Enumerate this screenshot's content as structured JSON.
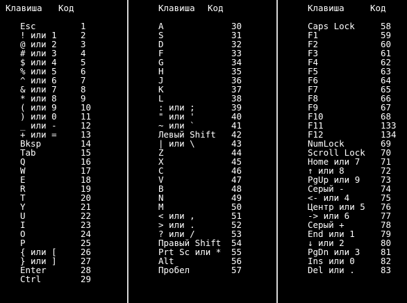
{
  "columns": [
    {
      "header_key": "Клавиша",
      "header_code": "Код",
      "rows": [
        {
          "key": "Esc",
          "code": "1"
        },
        {
          "key": "! или 1",
          "code": "2"
        },
        {
          "key": "@ или 2",
          "code": "3"
        },
        {
          "key": "# или 3",
          "code": "4"
        },
        {
          "key": "$ или 4",
          "code": "5"
        },
        {
          "key": "% или 5",
          "code": "6"
        },
        {
          "key": "^ или 6",
          "code": "7"
        },
        {
          "key": "& или 7",
          "code": "8"
        },
        {
          "key": "* или 8",
          "code": "9"
        },
        {
          "key": "( или 9",
          "code": "10"
        },
        {
          "key": ") или 0",
          "code": "11"
        },
        {
          "key": "_ или -",
          "code": "12"
        },
        {
          "key": "+ или =",
          "code": "13"
        },
        {
          "key": "Bksp",
          "code": "14"
        },
        {
          "key": "Tab",
          "code": "15"
        },
        {
          "key": "Q",
          "code": "16"
        },
        {
          "key": "W",
          "code": "17"
        },
        {
          "key": "E",
          "code": "18"
        },
        {
          "key": "R",
          "code": "19"
        },
        {
          "key": "T",
          "code": "20"
        },
        {
          "key": "Y",
          "code": "21"
        },
        {
          "key": "U",
          "code": "22"
        },
        {
          "key": "I",
          "code": "23"
        },
        {
          "key": "O",
          "code": "24"
        },
        {
          "key": "P",
          "code": "25"
        },
        {
          "key": "{ или [",
          "code": "26"
        },
        {
          "key": "} или ]",
          "code": "27"
        },
        {
          "key": "Enter",
          "code": "28"
        },
        {
          "key": "Ctrl",
          "code": "29"
        }
      ]
    },
    {
      "header_key": "Клавиша",
      "header_code": "Код",
      "rows": [
        {
          "key": "A",
          "code": "30"
        },
        {
          "key": "S",
          "code": "31"
        },
        {
          "key": "D",
          "code": "32"
        },
        {
          "key": "F",
          "code": "33"
        },
        {
          "key": "G",
          "code": "34"
        },
        {
          "key": "H",
          "code": "35"
        },
        {
          "key": "J",
          "code": "36"
        },
        {
          "key": "K",
          "code": "37"
        },
        {
          "key": "L",
          "code": "38"
        },
        {
          "key": ": или ;",
          "code": "39"
        },
        {
          "key": "\" или '",
          "code": "40"
        },
        {
          "key": "~ или `",
          "code": "41"
        },
        {
          "key": "Левый Shift",
          "code": "42"
        },
        {
          "key": "| или \\",
          "code": "43"
        },
        {
          "key": "Z",
          "code": "44"
        },
        {
          "key": "X",
          "code": "45"
        },
        {
          "key": "C",
          "code": "46"
        },
        {
          "key": "V",
          "code": "47"
        },
        {
          "key": "B",
          "code": "48"
        },
        {
          "key": "N",
          "code": "49"
        },
        {
          "key": "M",
          "code": "50"
        },
        {
          "key": "< или ,",
          "code": "51"
        },
        {
          "key": "> или .",
          "code": "52"
        },
        {
          "key": "? или /",
          "code": "53"
        },
        {
          "key": "Правый Shift",
          "code": "54"
        },
        {
          "key": "Prt Sc или *",
          "code": "55"
        },
        {
          "key": "Alt",
          "code": "56"
        },
        {
          "key": "Пробел",
          "code": "57"
        }
      ]
    },
    {
      "header_key": "Клавиша",
      "header_code": "Код",
      "rows": [
        {
          "key": "Caps Lock",
          "code": "58"
        },
        {
          "key": "F1",
          "code": "59"
        },
        {
          "key": "F2",
          "code": "60"
        },
        {
          "key": "F3",
          "code": "61"
        },
        {
          "key": "F4",
          "code": "62"
        },
        {
          "key": "F5",
          "code": "63"
        },
        {
          "key": "F6",
          "code": "64"
        },
        {
          "key": "F7",
          "code": "65"
        },
        {
          "key": "F8",
          "code": "66"
        },
        {
          "key": "F9",
          "code": "67"
        },
        {
          "key": "F10",
          "code": "68"
        },
        {
          "key": "F11",
          "code": "133"
        },
        {
          "key": "F12",
          "code": "134"
        },
        {
          "key": "NumLock",
          "code": "69"
        },
        {
          "key": "Scroll Lock",
          "code": "70"
        },
        {
          "key": "Home или 7",
          "code": "71"
        },
        {
          "key": "↑ или 8",
          "code": "72"
        },
        {
          "key": "PgUp или 9",
          "code": "73"
        },
        {
          "key": "Серый -",
          "code": "74"
        },
        {
          "key": "<- или 4",
          "code": "75"
        },
        {
          "key": "Центр или 5",
          "code": "76"
        },
        {
          "key": "-> или 6",
          "code": "77"
        },
        {
          "key": "Серый +",
          "code": "78"
        },
        {
          "key": "End или 1",
          "code": "79"
        },
        {
          "key": "↓ или 2",
          "code": "80"
        },
        {
          "key": "PgDn или 3",
          "code": "81"
        },
        {
          "key": "Ins или 0",
          "code": "82"
        },
        {
          "key": "Del или .",
          "code": "83"
        }
      ]
    }
  ]
}
